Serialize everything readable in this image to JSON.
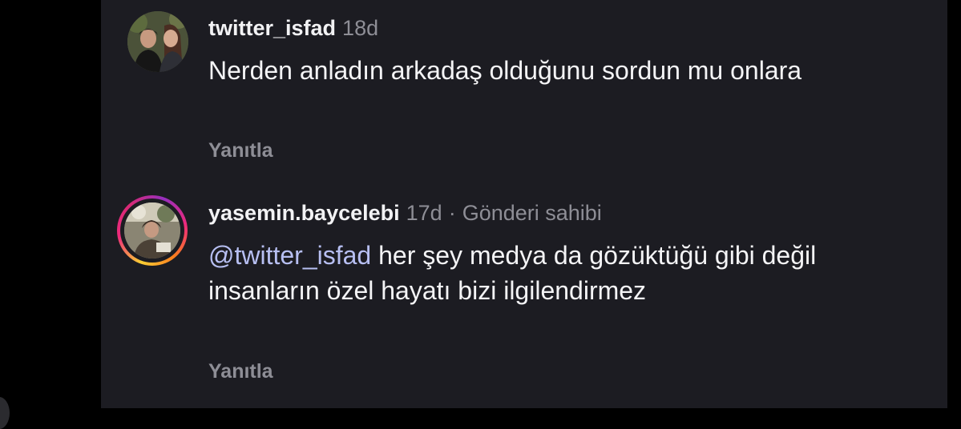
{
  "comments": [
    {
      "username": "twitter_isfad",
      "time": "18d",
      "text": "Nerden anladın arkadaş olduğunu sordun mu onlara",
      "reply_label": "Yanıtla"
    },
    {
      "username": "yasemin.baycelebi",
      "time": "17d",
      "separator": "·",
      "badge": "Gönderi sahibi",
      "mention": "@twitter_isfad",
      "text": "her şey medya da gözüktüğü gibi değil insanların özel hayatı bizi ilgilendirmez",
      "reply_label": "Yanıtla"
    }
  ],
  "colors": {
    "background": "#1c1c22",
    "primary_text": "#f4f4f6",
    "secondary_text": "#8e8e96",
    "mention": "#b7bff2",
    "story_ring": [
      "#f9ce34",
      "#ee2a7b",
      "#962fbf"
    ]
  }
}
